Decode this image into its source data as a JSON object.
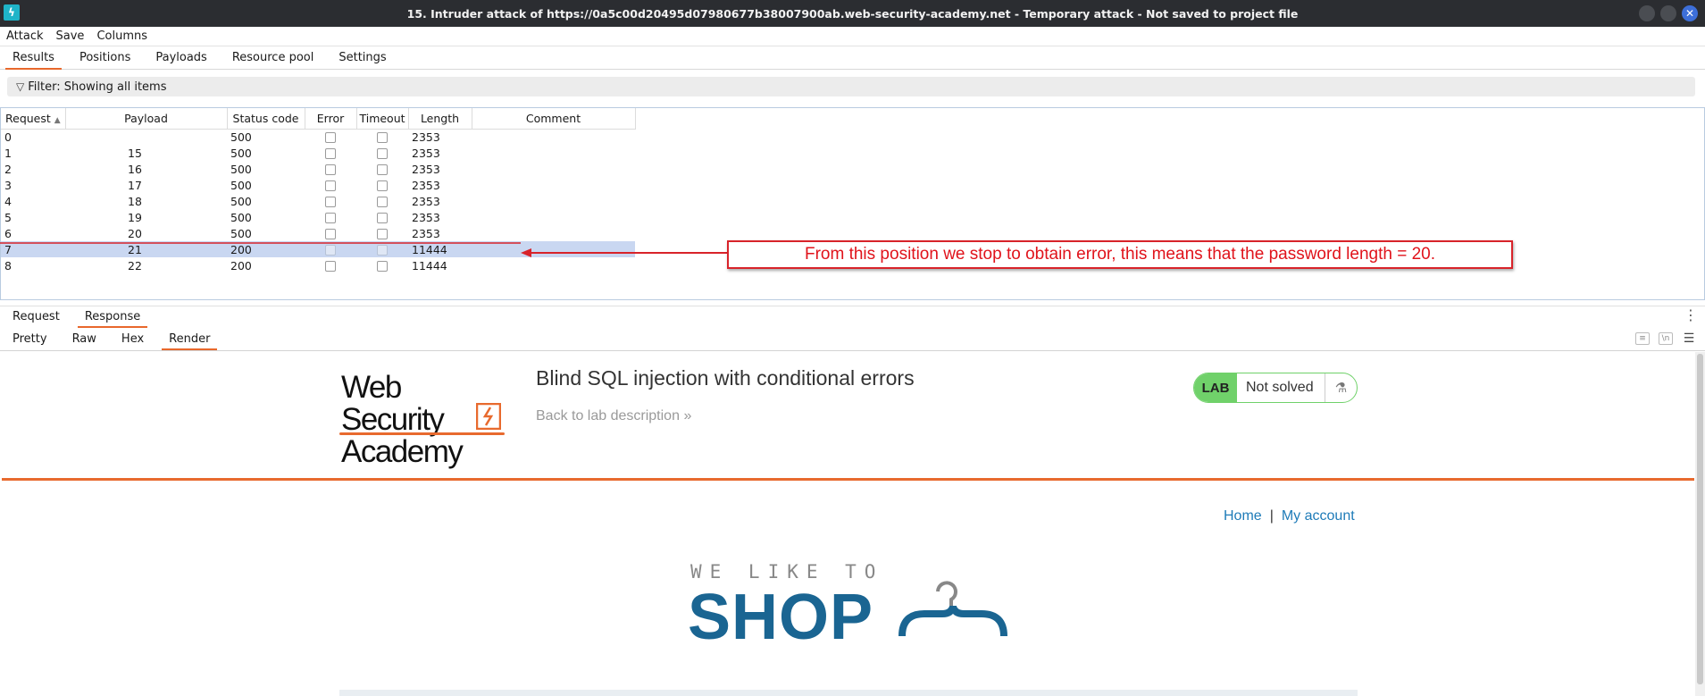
{
  "window": {
    "title": "15. Intruder attack of https://0a5c00d20495d07980677b38007900ab.web-security-academy.net - Temporary attack - Not saved to project file"
  },
  "menu": [
    "Attack",
    "Save",
    "Columns"
  ],
  "tabs": [
    "Results",
    "Positions",
    "Payloads",
    "Resource pool",
    "Settings"
  ],
  "filter": {
    "text": "Filter: Showing all items"
  },
  "table": {
    "headers": [
      "Request",
      "Payload",
      "Status code",
      "Error",
      "Timeout",
      "Length",
      "Comment"
    ],
    "rows": [
      {
        "request": "0",
        "payload": "",
        "status": "500",
        "length": "2353"
      },
      {
        "request": "1",
        "payload": "15",
        "status": "500",
        "length": "2353"
      },
      {
        "request": "2",
        "payload": "16",
        "status": "500",
        "length": "2353"
      },
      {
        "request": "3",
        "payload": "17",
        "status": "500",
        "length": "2353"
      },
      {
        "request": "4",
        "payload": "18",
        "status": "500",
        "length": "2353"
      },
      {
        "request": "5",
        "payload": "19",
        "status": "500",
        "length": "2353"
      },
      {
        "request": "6",
        "payload": "20",
        "status": "500",
        "length": "2353"
      },
      {
        "request": "7",
        "payload": "21",
        "status": "200",
        "length": "11444"
      },
      {
        "request": "8",
        "payload": "22",
        "status": "200",
        "length": "11444"
      }
    ]
  },
  "annotation": {
    "text": "From this position we stop to obtain error, this means that the password length = 20."
  },
  "lower_tabs": [
    "Request",
    "Response"
  ],
  "view_tabs": [
    "Pretty",
    "Raw",
    "Hex",
    "Render"
  ],
  "render": {
    "logo_line1": "Web Security",
    "logo_line2": "Academy",
    "lab_title": "Blind SQL injection with conditional errors",
    "back_link": "Back to lab description",
    "badge_label": "LAB",
    "badge_status": "Not solved",
    "nav_home": "Home",
    "nav_sep": "|",
    "nav_account": "My account",
    "shop_small": "WE LIKE TO",
    "shop_big": "SHOP"
  },
  "colors": {
    "accent": "#e8682c",
    "selected_row": "#c9d7f1",
    "annotation": "#d8232a",
    "lab_green": "#70d16a",
    "shop_blue": "#1a6592"
  }
}
